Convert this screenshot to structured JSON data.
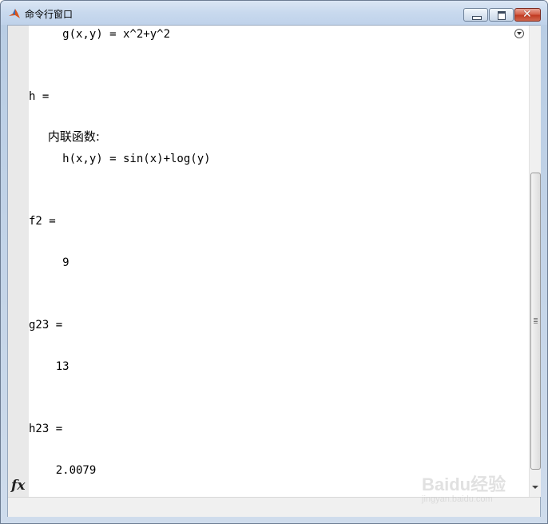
{
  "window": {
    "title": "命令行窗口",
    "minimize_label": "minimize",
    "maximize_label": "maximize",
    "close_label": "close"
  },
  "icons": {
    "app": "matlab-logo-icon",
    "dropdown": "circle-chevron-down-icon",
    "function": "fx-icon",
    "scroll_down": "arrow-down-icon"
  },
  "console": {
    "lines": [
      "     g(x,y) = x^2+y^2",
      "h =",
      "     内联函数:",
      "     h(x,y) = sin(x)+log(y)",
      "f2 =",
      "     9",
      "g23 =",
      "    13",
      "h23 =",
      "    2.0079"
    ]
  },
  "fx_label": "fx",
  "watermark": {
    "logo": "Baidu经验",
    "url": "jingyan.baidu.com"
  },
  "colors": {
    "title_bar": "#c8d9ee",
    "close_button": "#c23b22",
    "text": "#000000"
  }
}
